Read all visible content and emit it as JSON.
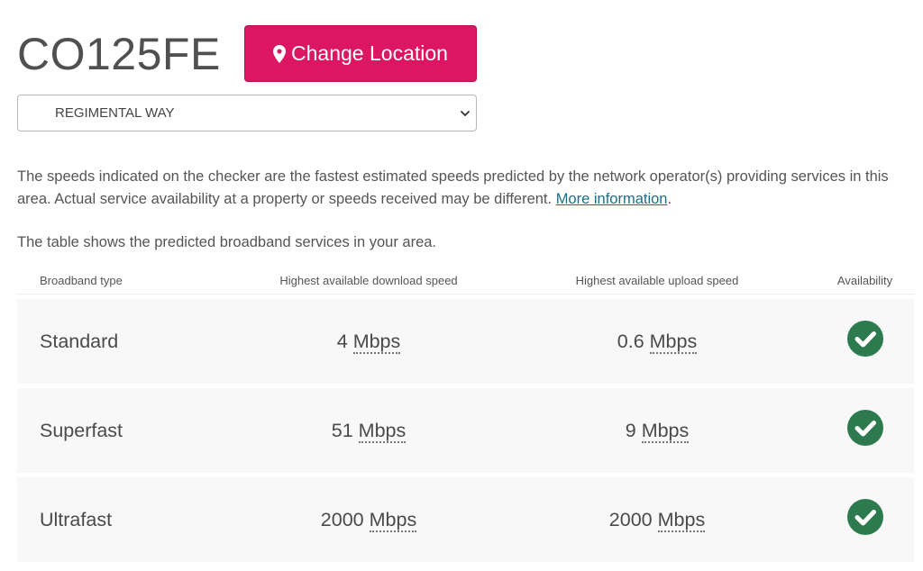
{
  "location": {
    "postcode": "CO125FE",
    "change_button_label": "Change Location",
    "street_selected": "REGIMENTAL WAY"
  },
  "info": {
    "text": "The speeds indicated on the checker are the fastest estimated speeds predicted by the network operator(s) providing services in this area. Actual service availability at a property or speeds received may be different.",
    "link_text": "More information",
    "link_suffix": "."
  },
  "table_intro": "The table shows the predicted broadband services in your area.",
  "table": {
    "headers": {
      "type": "Broadband type",
      "download": "Highest available download speed",
      "upload": "Highest available upload speed",
      "availability": "Availability"
    },
    "rows": [
      {
        "type": "Standard",
        "download_value": "4",
        "download_unit": "Mbps",
        "upload_value": "0.6",
        "upload_unit": "Mbps",
        "available": true
      },
      {
        "type": "Superfast",
        "download_value": "51",
        "download_unit": "Mbps",
        "upload_value": "9",
        "upload_unit": "Mbps",
        "available": true
      },
      {
        "type": "Ultrafast",
        "download_value": "2000",
        "download_unit": "Mbps",
        "upload_value": "2000",
        "upload_unit": "Mbps",
        "available": true
      }
    ]
  },
  "colors": {
    "accent": "#dd1663",
    "check": "#2c7a4e",
    "link": "#1a6f8a"
  },
  "icons": {
    "location": "map-marker-icon",
    "dropdown": "chevron-down-icon",
    "available": "check-circle-icon"
  }
}
